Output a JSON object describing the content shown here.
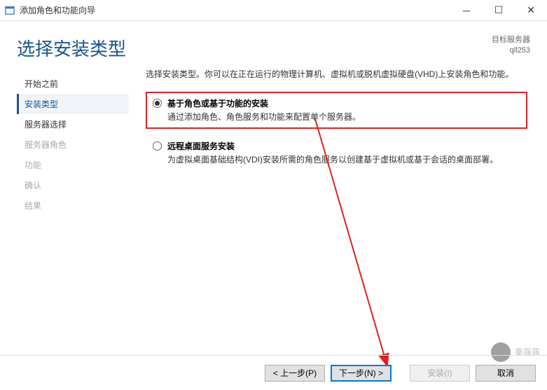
{
  "window": {
    "title": "添加角色和功能向导"
  },
  "header": {
    "page_title": "选择安装类型",
    "server_label": "目标服务器",
    "server_name": "qll253"
  },
  "sidebar": {
    "items": [
      {
        "label": "开始之前",
        "state": "normal"
      },
      {
        "label": "安装类型",
        "state": "active"
      },
      {
        "label": "服务器选择",
        "state": "normal"
      },
      {
        "label": "服务器角色",
        "state": "disabled"
      },
      {
        "label": "功能",
        "state": "disabled"
      },
      {
        "label": "确认",
        "state": "disabled"
      },
      {
        "label": "结果",
        "state": "disabled"
      }
    ]
  },
  "content": {
    "intro": "选择安装类型。你可以在正在运行的物理计算机、虚拟机或脱机虚拟硬盘(VHD)上安装角色和功能。",
    "options": [
      {
        "title": "基于角色或基于功能的安装",
        "desc": "通过添加角色、角色服务和功能来配置单个服务器。",
        "checked": true,
        "highlighted": true
      },
      {
        "title": "远程桌面服务安装",
        "desc": "为虚拟桌面基础结构(VDI)安装所需的角色服务以创建基于虚拟机或基于会话的桌面部署。",
        "checked": false,
        "highlighted": false
      }
    ]
  },
  "footer": {
    "prev": "< 上一步(P)",
    "next": "下一步(N) >",
    "install": "安装(I)",
    "cancel": "取消"
  },
  "watermark": {
    "text": "秦露露"
  }
}
